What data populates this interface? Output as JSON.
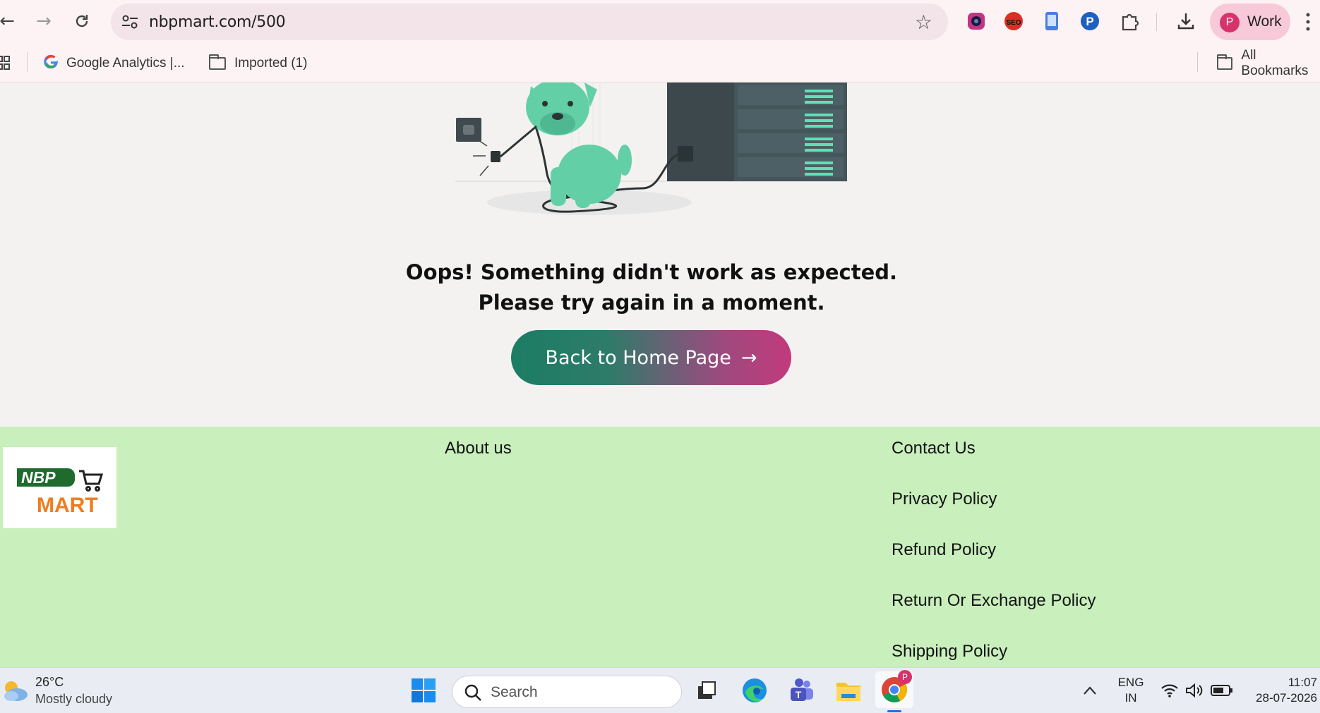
{
  "browser": {
    "url": "nbpmart.com/500",
    "profile_initial": "P",
    "profile_label": "Work",
    "bookmarks": [
      {
        "label": "Google Analytics  |..."
      },
      {
        "label": "Imported (1)"
      }
    ],
    "all_bookmarks_label": "All Bookmarks",
    "extension_badge": "SEO"
  },
  "error_page": {
    "message_line1": "Oops! Something didn't work as expected.",
    "message_line2": "Please try again in a moment.",
    "button_label": "Back to Home Page",
    "button_arrow": "→"
  },
  "footer": {
    "logo_top": "NBP",
    "logo_bottom": "MART",
    "about_label": "About us",
    "links": [
      "Contact Us",
      "Privacy Policy",
      "Refund Policy",
      "Return Or Exchange Policy",
      "Shipping Policy"
    ]
  },
  "taskbar": {
    "weather_temp": "26°C",
    "weather_desc": "Mostly cloudy",
    "search_label": "Search",
    "chrome_badge": "P",
    "lang_top": "ENG",
    "lang_bottom": "IN",
    "time": "11:07",
    "date": "28-07-2026"
  },
  "colors": {
    "footer_bg": "#c9efbc",
    "button_start": "#1b7d63",
    "button_end": "#c23a7c",
    "chrome_bg": "#fdf3f5",
    "profile_accent": "#d6336c"
  }
}
